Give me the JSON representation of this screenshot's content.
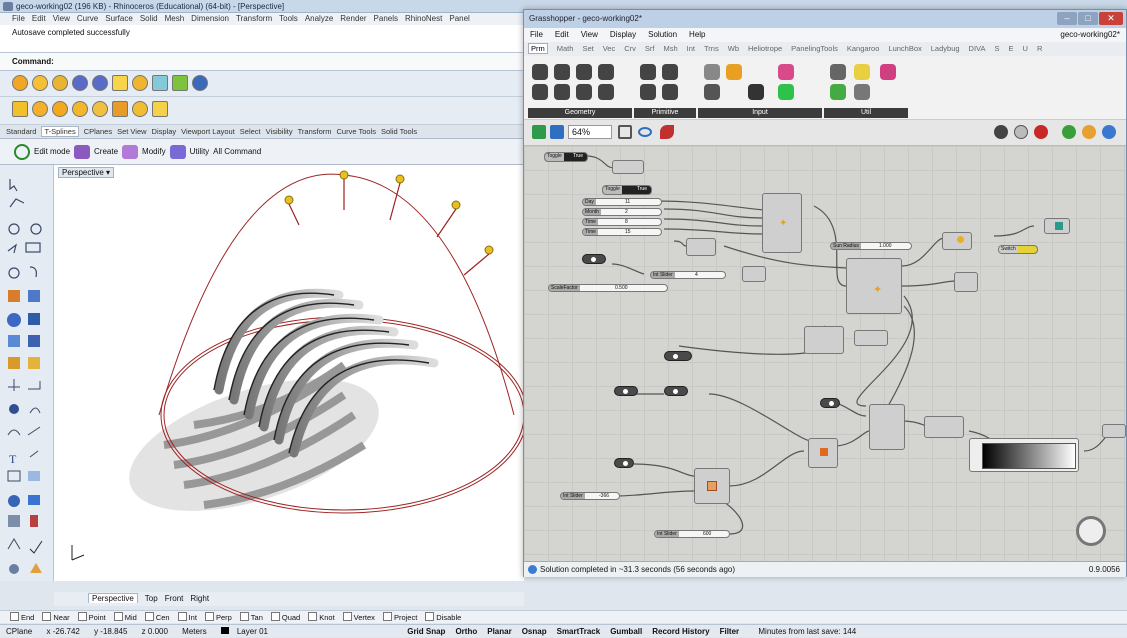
{
  "rhino": {
    "title": "geco-working02 (196 KB) - Rhinoceros (Educational) (64-bit) - [Perspective]",
    "menu": [
      "File",
      "Edit",
      "View",
      "Curve",
      "Surface",
      "Solid",
      "Mesh",
      "Dimension",
      "Transform",
      "Tools",
      "Analyze",
      "Render",
      "Panels",
      "RhinoNest",
      "Panel"
    ],
    "history": "Autosave completed successfully",
    "command_label": "Command:",
    "tabs": [
      "Standard",
      "T-Splines",
      "CPlanes",
      "Set View",
      "Display",
      "Viewport Layout",
      "Select",
      "Visibility",
      "Transform",
      "Curve Tools",
      "Solid Tools"
    ],
    "active_tab": "T-Splines",
    "tsplines_toolbar": [
      "Edit mode",
      "Create",
      "Modify",
      "Utility",
      "All Command"
    ],
    "viewport_label": "Perspective",
    "view_tabs": [
      "Perspective",
      "Top",
      "Front",
      "Right"
    ],
    "osnaps": [
      "End",
      "Near",
      "Point",
      "Mid",
      "Cen",
      "Int",
      "Perp",
      "Tan",
      "Quad",
      "Knot",
      "Vertex",
      "Project",
      "Disable"
    ],
    "status": {
      "cplane": "CPlane",
      "x": "x -26.742",
      "y": "y -18.845",
      "z": "z 0.000",
      "units": "Meters",
      "layer": "Layer 01",
      "toggles": [
        "Grid Snap",
        "Ortho",
        "Planar",
        "Osnap",
        "SmartTrack",
        "Gumball",
        "Record History",
        "Filter"
      ],
      "save": "Minutes from last save: 144"
    }
  },
  "gh": {
    "title": "Grasshopper - geco-working02*",
    "menu": [
      "File",
      "Edit",
      "View",
      "Display",
      "Solution",
      "Help"
    ],
    "doc_name": "geco-working02*",
    "tabs": [
      "Prm",
      "Math",
      "Set",
      "Vec",
      "Crv",
      "Srf",
      "Msh",
      "Int",
      "Trns",
      "Wb",
      "Heliotrope",
      "PanelingTools",
      "Kangaroo",
      "LunchBox",
      "Ladybug",
      "DIVA",
      "S",
      "E",
      "U",
      "R"
    ],
    "groups": [
      "Geometry",
      "Primitive",
      "Input",
      "Util"
    ],
    "zoom": "64%",
    "status_text": "Solution completed in ~31.3 seconds (56 seconds ago)",
    "version": "0.9.0056",
    "nodes": {
      "toggle1": "Toggle",
      "toggle1_val": "True",
      "toggle2": "Toggle",
      "toggle2_val": "True",
      "day": "Day",
      "day_val": "11",
      "month": "Month",
      "month_val": "2",
      "time": "Time",
      "time_val": "8",
      "time2": "Time",
      "time2_val": "15",
      "sun_radius": "Sun Radius",
      "sun_radius_val": "1.000",
      "int_slider": "Int Slider",
      "int_slider_val": "4",
      "scale": "ScaleFactor",
      "scale_val": "0.500",
      "switch": "Switch",
      "int_slider2": "Int Slider",
      "int_slider2_val": "-366",
      "int_slider3": "Int Slider",
      "int_slider3_val": "600"
    }
  }
}
